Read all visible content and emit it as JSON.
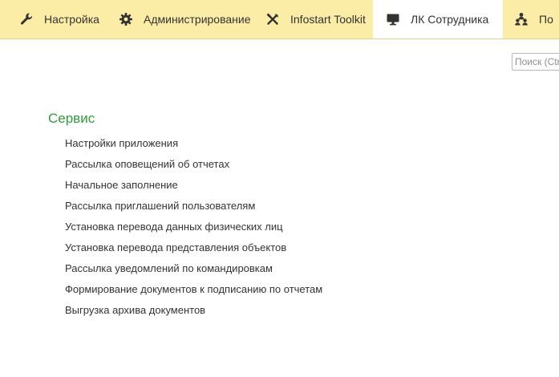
{
  "sections": [
    {
      "label": "Настройка",
      "icon": "wrench-icon"
    },
    {
      "label": "Администрирование",
      "icon": "gear-icon"
    },
    {
      "label": "Infostart Toolkit",
      "icon": "tools-icon"
    },
    {
      "label": "ЛК Сотрудника",
      "icon": "monitor-icon",
      "active": true
    },
    {
      "label": "По",
      "icon": "people-icon"
    }
  ],
  "search": {
    "placeholder": "Поиск (Ctrl+F)"
  },
  "group": {
    "title": "Сервис",
    "commands": [
      "Настройки приложения",
      "Рассылка оповещений об отчетах",
      "Начальное заполнение",
      "Рассылка приглашений пользователям",
      "Установка перевода данных физических лиц",
      "Установка перевода представления объектов",
      "Рассылка уведомлений по командировкам",
      "Формирование документов к подписанию по отчетам",
      "Выгрузка архива документов"
    ]
  },
  "colors": {
    "section_bar": "#fbeca6",
    "group_title": "#2e9e3c",
    "active_tab": "#ffffff"
  }
}
